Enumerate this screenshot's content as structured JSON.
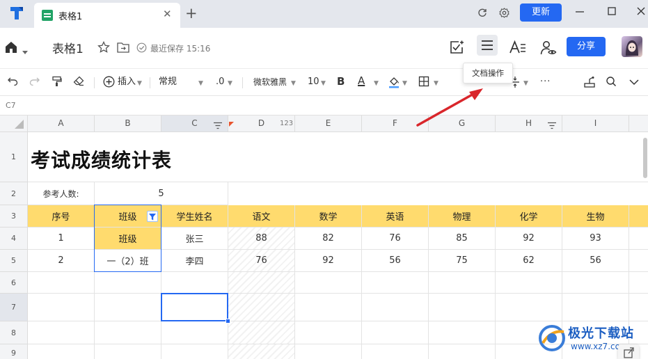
{
  "tabbar": {
    "tab_title": "表格1",
    "update_label": "更新",
    "new_tab_label": "+"
  },
  "header": {
    "doc_title": "表格1",
    "save_status": "最近保存 15:16",
    "share_label": "分享"
  },
  "toolbar": {
    "insert_label": "插入",
    "format_value": "常规",
    "decimal_value": ".0",
    "font_value": "微软雅黑",
    "size_value": "10",
    "bold_label": "B",
    "font_color_label": "A",
    "more_label": "···"
  },
  "tooltip": "文档操作",
  "formula_bar": {
    "cell_ref": "C7"
  },
  "sheet": {
    "columns": [
      "A",
      "B",
      "C",
      "D",
      "E",
      "F",
      "G",
      "H",
      "I"
    ],
    "column_d_format_badge": "123",
    "rows": [
      "1",
      "2",
      "3",
      "4",
      "5",
      "6",
      "7",
      "8",
      "9"
    ],
    "title": "考试成绩统计表",
    "participants_label": "参考人数:",
    "participants_value": "5",
    "headers": [
      "序号",
      "班级",
      "学生姓名",
      "语文",
      "数学",
      "英语",
      "物理",
      "化学",
      "生物"
    ],
    "data": [
      [
        "1",
        "班级",
        "张三",
        "88",
        "82",
        "76",
        "85",
        "92",
        "93"
      ],
      [
        "2",
        "一（2）班",
        "李四",
        "76",
        "92",
        "56",
        "75",
        "62",
        "56"
      ]
    ]
  },
  "watermark": {
    "text": "极光下载站",
    "url": "www.xz7.com"
  },
  "colors": {
    "accent": "#2468f2",
    "header_fill": "#ffdb6e",
    "selection": "#2468f2",
    "arrow": "#d9262b",
    "tabbar_bg": "#e4e7ed"
  }
}
